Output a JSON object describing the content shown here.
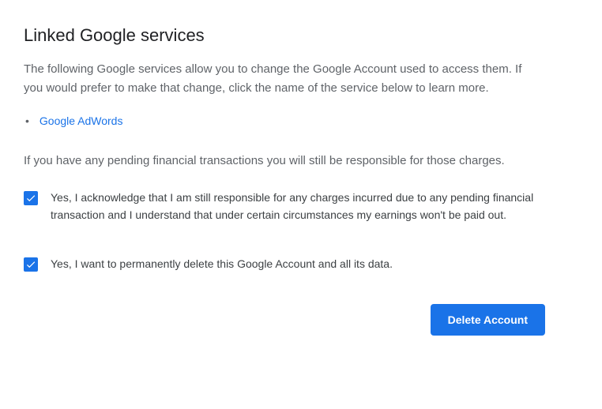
{
  "heading": "Linked Google services",
  "intro": "The following Google services allow you to change the Google Account used to access them. If you would prefer to make that change, click the name of the service below to learn more.",
  "services": [
    {
      "label": "Google AdWords"
    }
  ],
  "pending_text": "If you have any pending financial transactions you will still be responsible for those charges.",
  "checkboxes": [
    {
      "label": "Yes, I acknowledge that I am still responsible for any charges incurred due to any pending financial transaction and I understand that under certain circum­stances my earnings won't be paid out.",
      "checked": true
    },
    {
      "label": "Yes, I want to permanently delete this Google Account and all its data.",
      "checked": true
    }
  ],
  "delete_button_label": "Delete Account"
}
